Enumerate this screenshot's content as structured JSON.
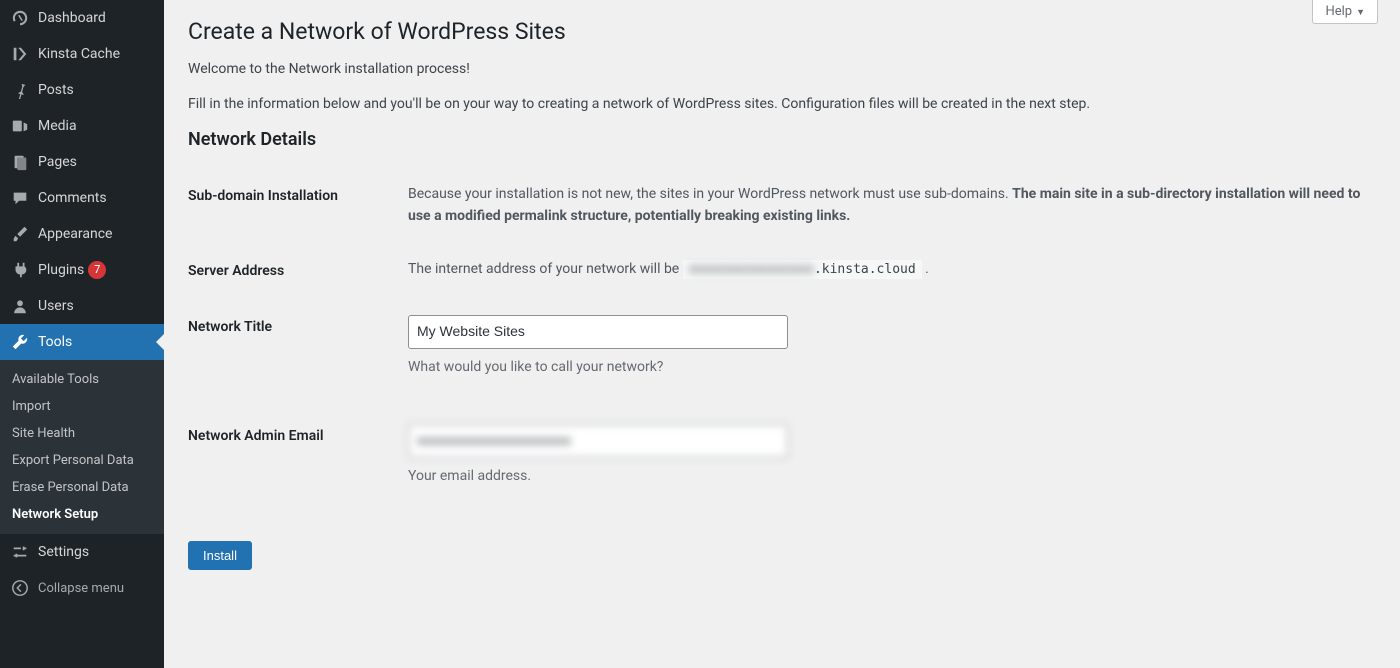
{
  "sidebar": {
    "items": [
      {
        "label": "Dashboard",
        "icon": "dashboard"
      },
      {
        "label": "Kinsta Cache",
        "icon": "kinsta"
      },
      {
        "label": "Posts",
        "icon": "pin"
      },
      {
        "label": "Media",
        "icon": "media"
      },
      {
        "label": "Pages",
        "icon": "pages"
      },
      {
        "label": "Comments",
        "icon": "comment"
      },
      {
        "label": "Appearance",
        "icon": "brush"
      },
      {
        "label": "Plugins",
        "icon": "plug",
        "badge": "7"
      },
      {
        "label": "Users",
        "icon": "user"
      },
      {
        "label": "Tools",
        "icon": "wrench",
        "current": true
      },
      {
        "label": "Settings",
        "icon": "sliders"
      }
    ],
    "submenu": [
      {
        "label": "Available Tools"
      },
      {
        "label": "Import"
      },
      {
        "label": "Site Health"
      },
      {
        "label": "Export Personal Data"
      },
      {
        "label": "Erase Personal Data"
      },
      {
        "label": "Network Setup",
        "current": true
      }
    ],
    "collapse": "Collapse menu"
  },
  "help": "Help",
  "page": {
    "title": "Create a Network of WordPress Sites",
    "intro1": "Welcome to the Network installation process!",
    "intro2": "Fill in the information below and you'll be on your way to creating a network of WordPress sites. Configuration files will be created in the next step.",
    "details_heading": "Network Details",
    "rows": {
      "subdomain": {
        "th": "Sub-domain Installation",
        "plain": "Because your installation is not new, the sites in your WordPress network must use sub-domains. ",
        "bold": "The main site in a sub-directory installation will need to use a modified permalink structure, potentially breaking existing links."
      },
      "server": {
        "th": "Server Address",
        "lead": "The internet address of your network will be ",
        "hidden": "xxxxxxxxxxxxxxxx",
        "domain": ".kinsta.cloud",
        "tail": " ."
      },
      "title": {
        "th": "Network Title",
        "value": "My Website Sites",
        "desc": "What would you like to call your network?"
      },
      "email": {
        "th": "Network Admin Email",
        "value": "xxxxxxxxxxxxxxxxxxxxxx",
        "desc": "Your email address."
      }
    },
    "submit": "Install"
  }
}
